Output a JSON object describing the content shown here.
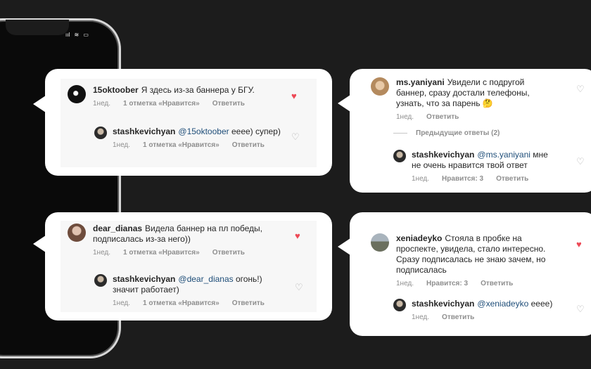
{
  "colors": {
    "background": "#1c1c1c",
    "like": "#ed4956",
    "mention": "#1f4e79"
  },
  "phone": {
    "status": [
      "ııl",
      "≋",
      "▭"
    ]
  },
  "cards": [
    {
      "comment": {
        "user": "15oktoober",
        "text": "Я здесь из-за баннера у БГУ.",
        "time": "1нед.",
        "likes": "1 отметка «Нравится»",
        "reply": "Ответить",
        "liked": true
      },
      "reply": {
        "user": "stashkevichyan",
        "mention": "@15oktoober",
        "text": "eeee) супер)",
        "time": "1нед.",
        "likes": "1 отметка «Нравится»",
        "reply": "Ответить",
        "liked": false
      }
    },
    {
      "comment": {
        "user": "ms.yaniyani",
        "text": "Увидели с подругой баннер, сразу достали телефоны, узнать, что за парень 🤔",
        "time": "1нед.",
        "reply": "Ответить",
        "liked": false
      },
      "previous_replies": "Предыдущие ответы (2)",
      "reply": {
        "user": "stashkevichyan",
        "mention": "@ms.yaniyani",
        "text": "мне не очень нравится твой ответ",
        "time": "1нед.",
        "likes": "Нравится: 3",
        "reply": "Ответить",
        "liked": false
      }
    },
    {
      "comment": {
        "user": "dear_dianas",
        "text": "Видела баннер на пл победы, подписалась из-за него))",
        "time": "1нед.",
        "likes": "1 отметка «Нравится»",
        "reply": "Ответить",
        "liked": true
      },
      "reply": {
        "user": "stashkevichyan",
        "mention": "@dear_dianas",
        "text": "огонь!) значит работает)",
        "time": "1нед.",
        "likes": "1 отметка «Нравится»",
        "reply": "Ответить",
        "liked": false
      }
    },
    {
      "comment": {
        "user": "xeniadeyko",
        "text": "Стояла в пробке на проспекте, увидела, стало интересно. Сразу подписалась не знаю зачем, но подписалась",
        "time": "1нед.",
        "likes": "Нравится: 3",
        "reply": "Ответить",
        "liked": true
      },
      "reply": {
        "user": "stashkevichyan",
        "mention": "@xeniadeyko",
        "text": "eeee)",
        "time": "1нед.",
        "reply": "Ответить",
        "liked": false
      }
    }
  ]
}
